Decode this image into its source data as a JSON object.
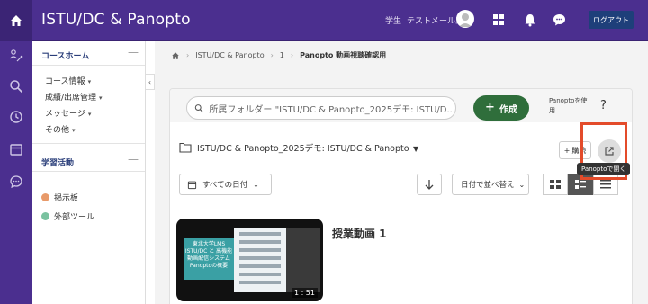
{
  "header": {
    "app_title": "ISTU/DC & Panopto",
    "user_role": "学生",
    "user_name": "テストメール三",
    "logout_label": "ログアウト"
  },
  "rail": {
    "icons": [
      "home-icon",
      "user-path-icon",
      "search-icon",
      "clock-icon",
      "calendar-icon",
      "chat-icon"
    ]
  },
  "course_nav": {
    "home_label": "コースホーム",
    "items": [
      {
        "label": "コース情報"
      },
      {
        "label": "成績/出席管理"
      },
      {
        "label": "メッセージ"
      },
      {
        "label": "その他"
      }
    ],
    "section_label": "学習活動",
    "tools": [
      {
        "label": "掲示板",
        "color": "#e89a6a"
      },
      {
        "label": "外部ツール",
        "color": "#7ac2a0"
      }
    ],
    "collapse_glyph": "—",
    "handle_glyph": "‹"
  },
  "breadcrumb": {
    "items": [
      "ISTU/DC & Panopto",
      "1"
    ],
    "current": "Panopto 動画視聴確認用"
  },
  "panopto": {
    "search_placeholder": "所属フォルダー \"ISTU/DC & Panopto_2025デモ: ISTU/D...",
    "create_label": "作成",
    "use_panopto": "Panoptoを使用",
    "help": "?",
    "folder_name": "ISTU/DC & Panopto_2025デモ: ISTU/DC & Panopto",
    "add_label": "購読",
    "tooltip": "Panoptoで開く",
    "date_filter": "すべての日付",
    "sort_label": "日付で並べ替え",
    "video": {
      "title": "授業動画 1",
      "duration": "1 : 51",
      "slide_text": "東北大学LMS ISTU/DC と 高機能 動画配信システム Panoptoの概要"
    }
  },
  "colors": {
    "brand_purple": "#4b2f8f",
    "create_green": "#2f6e3b",
    "highlight_red": "#e34b2a"
  }
}
